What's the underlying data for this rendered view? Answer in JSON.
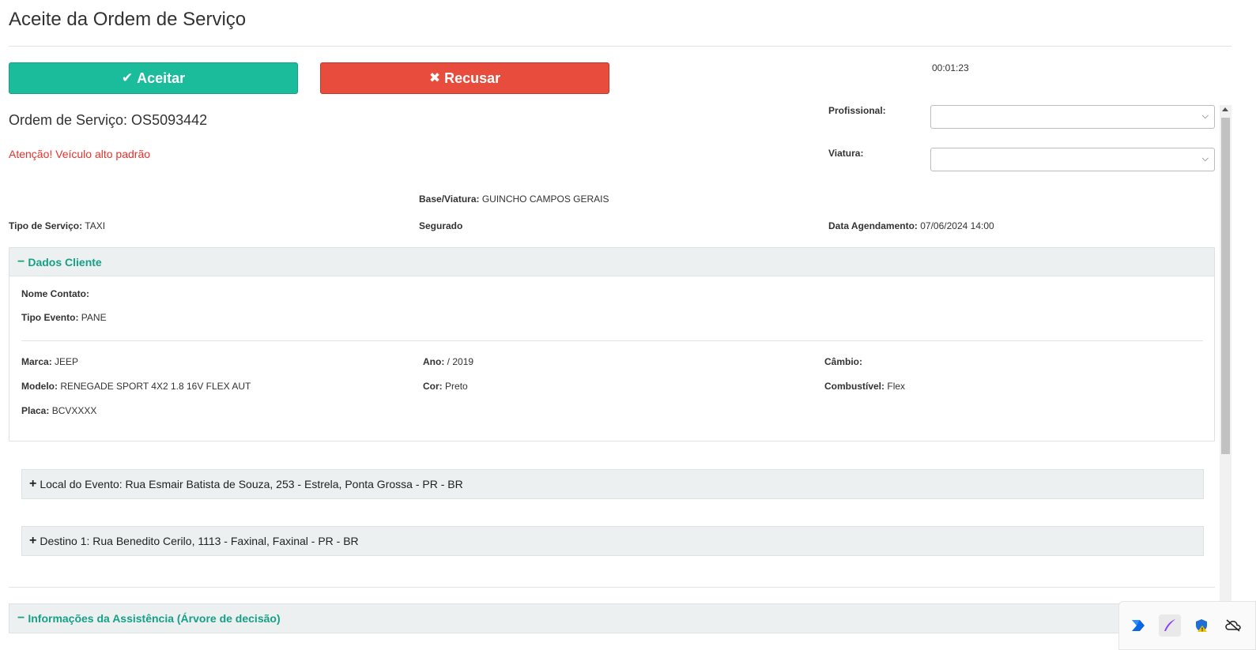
{
  "header": {
    "title": "Aceite da Ordem de Serviço"
  },
  "actions": {
    "accept_label": "Aceitar",
    "refuse_label": "Recusar"
  },
  "timer": "00:01:23",
  "order": {
    "label": "Ordem de Serviço: OS5093442",
    "warning": "Atenção! Veículo alto padrão"
  },
  "assign": {
    "profissional_label": "Profissional:",
    "profissional_value": "",
    "viatura_label": "Viatura:",
    "viatura_value": ""
  },
  "summary": {
    "base_label": "Base/Viatura:",
    "base_value": "GUINCHO CAMPOS GERAIS",
    "tipo_label": "Tipo de Serviço:",
    "tipo_value": "TAXI",
    "segurado_label": "Segurado",
    "agendamento_label": "Data Agendamento:",
    "agendamento_value": "07/06/2024 14:00"
  },
  "cliente": {
    "title": "Dados Cliente",
    "nome_label": "Nome Contato:",
    "nome_value": "",
    "evento_label": "Tipo Evento:",
    "evento_value": "PANE",
    "marca_label": "Marca:",
    "marca_value": "JEEP",
    "ano_label": "Ano:",
    "ano_value": "/ 2019",
    "cambio_label": "Câmbio:",
    "cambio_value": "",
    "modelo_label": "Modelo:",
    "modelo_value": "RENEGADE SPORT 4X2 1.8 16V FLEX AUT",
    "cor_label": "Cor:",
    "cor_value": "Preto",
    "combustivel_label": "Combustível:",
    "combustivel_value": "Flex",
    "placa_label": "Placa:",
    "placa_value": "BCVXXXX"
  },
  "local": {
    "text": "Local do Evento: Rua Esmair Batista de Souza, 253 - Estrela, Ponta Grossa - PR - BR"
  },
  "destino": {
    "text": "Destino 1: Rua Benedito Cerilo, 1113 - Faxinal, Faxinal - PR - BR"
  },
  "assistencia": {
    "title": "Informações da Assistência (Árvore de decisão)"
  },
  "tray_icons": [
    "power-automate-icon",
    "pen-icon",
    "defender-warning-icon",
    "cloud-off-icon"
  ],
  "colors": {
    "accept": "#1abc9c",
    "refuse": "#e74c3c",
    "warning": "#e8322b",
    "panel_title": "#16a085"
  }
}
